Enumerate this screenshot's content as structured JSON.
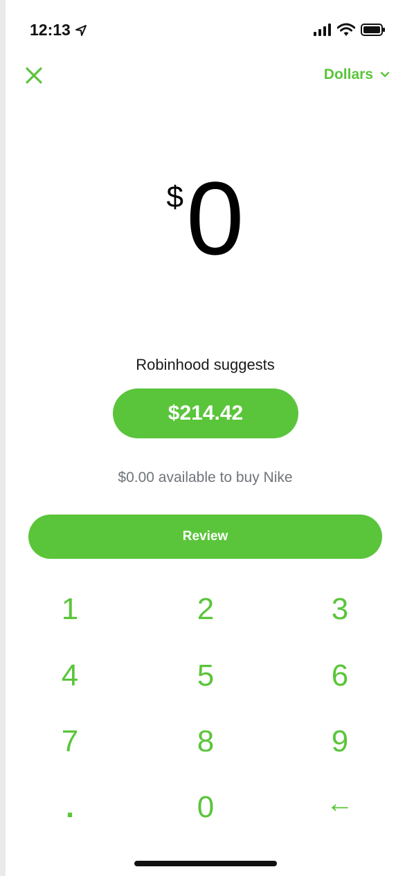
{
  "status_bar": {
    "time": "12:13",
    "icons": [
      "location-arrow-icon",
      "cellular-signal-icon",
      "wifi-icon",
      "battery-icon"
    ]
  },
  "header": {
    "close_icon": "close-icon",
    "currency_label": "Dollars",
    "currency_chevron": "chevron-down-icon"
  },
  "amount": {
    "symbol": "$",
    "value": "0"
  },
  "suggestion": {
    "label": "Robinhood suggests",
    "amount": "$214.42"
  },
  "available": {
    "text": "$0.00 available to buy Nike"
  },
  "review_button": {
    "label": "Review"
  },
  "keypad": {
    "keys": [
      "1",
      "2",
      "3",
      "4",
      "5",
      "6",
      "7",
      "8",
      "9",
      ".",
      "0",
      "←"
    ]
  },
  "colors": {
    "accent": "#5ac53b",
    "text": "#000000",
    "muted": "#6f7479",
    "background": "#ffffff"
  }
}
